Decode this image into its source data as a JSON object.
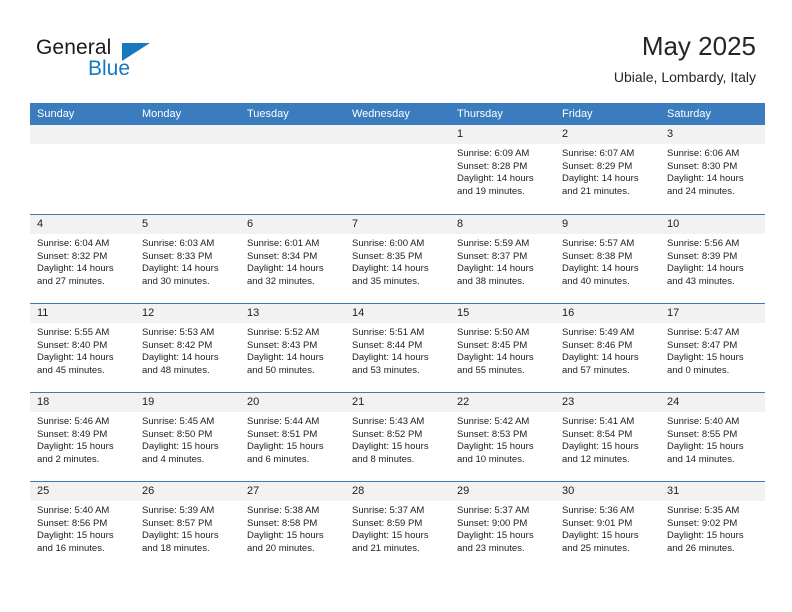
{
  "brand": {
    "word_one": "General",
    "word_two": "Blue",
    "accent_color": "#1878be"
  },
  "header": {
    "title": "May 2025",
    "subtitle": "Ubiale, Lombardy, Italy"
  },
  "theme": {
    "header_row_bg": "#3a7cbe",
    "day_number_bg": "#f2f2f2",
    "text_color": "#1d1d1d"
  },
  "weekdays": [
    "Sunday",
    "Monday",
    "Tuesday",
    "Wednesday",
    "Thursday",
    "Friday",
    "Saturday"
  ],
  "weeks": [
    [
      {
        "day": "",
        "sunrise": "",
        "sunset": "",
        "daylight_line1": "",
        "daylight_line2": ""
      },
      {
        "day": "",
        "sunrise": "",
        "sunset": "",
        "daylight_line1": "",
        "daylight_line2": ""
      },
      {
        "day": "",
        "sunrise": "",
        "sunset": "",
        "daylight_line1": "",
        "daylight_line2": ""
      },
      {
        "day": "",
        "sunrise": "",
        "sunset": "",
        "daylight_line1": "",
        "daylight_line2": ""
      },
      {
        "day": "1",
        "sunrise": "Sunrise: 6:09 AM",
        "sunset": "Sunset: 8:28 PM",
        "daylight_line1": "Daylight: 14 hours",
        "daylight_line2": "and 19 minutes."
      },
      {
        "day": "2",
        "sunrise": "Sunrise: 6:07 AM",
        "sunset": "Sunset: 8:29 PM",
        "daylight_line1": "Daylight: 14 hours",
        "daylight_line2": "and 21 minutes."
      },
      {
        "day": "3",
        "sunrise": "Sunrise: 6:06 AM",
        "sunset": "Sunset: 8:30 PM",
        "daylight_line1": "Daylight: 14 hours",
        "daylight_line2": "and 24 minutes."
      }
    ],
    [
      {
        "day": "4",
        "sunrise": "Sunrise: 6:04 AM",
        "sunset": "Sunset: 8:32 PM",
        "daylight_line1": "Daylight: 14 hours",
        "daylight_line2": "and 27 minutes."
      },
      {
        "day": "5",
        "sunrise": "Sunrise: 6:03 AM",
        "sunset": "Sunset: 8:33 PM",
        "daylight_line1": "Daylight: 14 hours",
        "daylight_line2": "and 30 minutes."
      },
      {
        "day": "6",
        "sunrise": "Sunrise: 6:01 AM",
        "sunset": "Sunset: 8:34 PM",
        "daylight_line1": "Daylight: 14 hours",
        "daylight_line2": "and 32 minutes."
      },
      {
        "day": "7",
        "sunrise": "Sunrise: 6:00 AM",
        "sunset": "Sunset: 8:35 PM",
        "daylight_line1": "Daylight: 14 hours",
        "daylight_line2": "and 35 minutes."
      },
      {
        "day": "8",
        "sunrise": "Sunrise: 5:59 AM",
        "sunset": "Sunset: 8:37 PM",
        "daylight_line1": "Daylight: 14 hours",
        "daylight_line2": "and 38 minutes."
      },
      {
        "day": "9",
        "sunrise": "Sunrise: 5:57 AM",
        "sunset": "Sunset: 8:38 PM",
        "daylight_line1": "Daylight: 14 hours",
        "daylight_line2": "and 40 minutes."
      },
      {
        "day": "10",
        "sunrise": "Sunrise: 5:56 AM",
        "sunset": "Sunset: 8:39 PM",
        "daylight_line1": "Daylight: 14 hours",
        "daylight_line2": "and 43 minutes."
      }
    ],
    [
      {
        "day": "11",
        "sunrise": "Sunrise: 5:55 AM",
        "sunset": "Sunset: 8:40 PM",
        "daylight_line1": "Daylight: 14 hours",
        "daylight_line2": "and 45 minutes."
      },
      {
        "day": "12",
        "sunrise": "Sunrise: 5:53 AM",
        "sunset": "Sunset: 8:42 PM",
        "daylight_line1": "Daylight: 14 hours",
        "daylight_line2": "and 48 minutes."
      },
      {
        "day": "13",
        "sunrise": "Sunrise: 5:52 AM",
        "sunset": "Sunset: 8:43 PM",
        "daylight_line1": "Daylight: 14 hours",
        "daylight_line2": "and 50 minutes."
      },
      {
        "day": "14",
        "sunrise": "Sunrise: 5:51 AM",
        "sunset": "Sunset: 8:44 PM",
        "daylight_line1": "Daylight: 14 hours",
        "daylight_line2": "and 53 minutes."
      },
      {
        "day": "15",
        "sunrise": "Sunrise: 5:50 AM",
        "sunset": "Sunset: 8:45 PM",
        "daylight_line1": "Daylight: 14 hours",
        "daylight_line2": "and 55 minutes."
      },
      {
        "day": "16",
        "sunrise": "Sunrise: 5:49 AM",
        "sunset": "Sunset: 8:46 PM",
        "daylight_line1": "Daylight: 14 hours",
        "daylight_line2": "and 57 minutes."
      },
      {
        "day": "17",
        "sunrise": "Sunrise: 5:47 AM",
        "sunset": "Sunset: 8:47 PM",
        "daylight_line1": "Daylight: 15 hours",
        "daylight_line2": "and 0 minutes."
      }
    ],
    [
      {
        "day": "18",
        "sunrise": "Sunrise: 5:46 AM",
        "sunset": "Sunset: 8:49 PM",
        "daylight_line1": "Daylight: 15 hours",
        "daylight_line2": "and 2 minutes."
      },
      {
        "day": "19",
        "sunrise": "Sunrise: 5:45 AM",
        "sunset": "Sunset: 8:50 PM",
        "daylight_line1": "Daylight: 15 hours",
        "daylight_line2": "and 4 minutes."
      },
      {
        "day": "20",
        "sunrise": "Sunrise: 5:44 AM",
        "sunset": "Sunset: 8:51 PM",
        "daylight_line1": "Daylight: 15 hours",
        "daylight_line2": "and 6 minutes."
      },
      {
        "day": "21",
        "sunrise": "Sunrise: 5:43 AM",
        "sunset": "Sunset: 8:52 PM",
        "daylight_line1": "Daylight: 15 hours",
        "daylight_line2": "and 8 minutes."
      },
      {
        "day": "22",
        "sunrise": "Sunrise: 5:42 AM",
        "sunset": "Sunset: 8:53 PM",
        "daylight_line1": "Daylight: 15 hours",
        "daylight_line2": "and 10 minutes."
      },
      {
        "day": "23",
        "sunrise": "Sunrise: 5:41 AM",
        "sunset": "Sunset: 8:54 PM",
        "daylight_line1": "Daylight: 15 hours",
        "daylight_line2": "and 12 minutes."
      },
      {
        "day": "24",
        "sunrise": "Sunrise: 5:40 AM",
        "sunset": "Sunset: 8:55 PM",
        "daylight_line1": "Daylight: 15 hours",
        "daylight_line2": "and 14 minutes."
      }
    ],
    [
      {
        "day": "25",
        "sunrise": "Sunrise: 5:40 AM",
        "sunset": "Sunset: 8:56 PM",
        "daylight_line1": "Daylight: 15 hours",
        "daylight_line2": "and 16 minutes."
      },
      {
        "day": "26",
        "sunrise": "Sunrise: 5:39 AM",
        "sunset": "Sunset: 8:57 PM",
        "daylight_line1": "Daylight: 15 hours",
        "daylight_line2": "and 18 minutes."
      },
      {
        "day": "27",
        "sunrise": "Sunrise: 5:38 AM",
        "sunset": "Sunset: 8:58 PM",
        "daylight_line1": "Daylight: 15 hours",
        "daylight_line2": "and 20 minutes."
      },
      {
        "day": "28",
        "sunrise": "Sunrise: 5:37 AM",
        "sunset": "Sunset: 8:59 PM",
        "daylight_line1": "Daylight: 15 hours",
        "daylight_line2": "and 21 minutes."
      },
      {
        "day": "29",
        "sunrise": "Sunrise: 5:37 AM",
        "sunset": "Sunset: 9:00 PM",
        "daylight_line1": "Daylight: 15 hours",
        "daylight_line2": "and 23 minutes."
      },
      {
        "day": "30",
        "sunrise": "Sunrise: 5:36 AM",
        "sunset": "Sunset: 9:01 PM",
        "daylight_line1": "Daylight: 15 hours",
        "daylight_line2": "and 25 minutes."
      },
      {
        "day": "31",
        "sunrise": "Sunrise: 5:35 AM",
        "sunset": "Sunset: 9:02 PM",
        "daylight_line1": "Daylight: 15 hours",
        "daylight_line2": "and 26 minutes."
      }
    ]
  ]
}
